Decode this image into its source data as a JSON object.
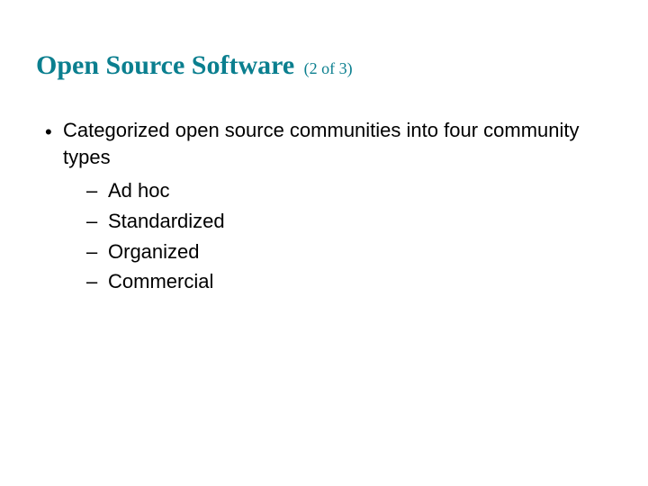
{
  "title": {
    "main": "Open Source Software",
    "suffix": "(2 of 3)"
  },
  "bullet": {
    "marker": "•",
    "text": "Categorized open source communities into four community types"
  },
  "sub_marker": "–",
  "sub_items": [
    "Ad hoc",
    "Standardized",
    "Organized",
    "Commercial"
  ]
}
